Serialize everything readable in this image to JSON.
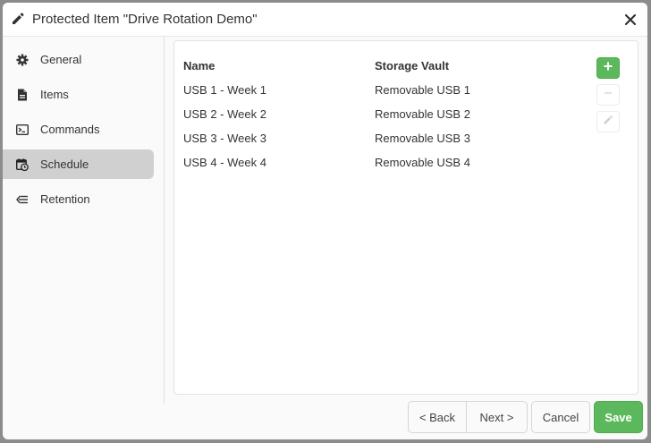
{
  "dialog": {
    "title": "Protected Item \"Drive Rotation Demo\"",
    "title_icon": "pencil-icon",
    "close_icon": "close-icon"
  },
  "sidebar": {
    "items": [
      {
        "label": "General",
        "icon": "gear-icon",
        "active": false
      },
      {
        "label": "Items",
        "icon": "document-icon",
        "active": false
      },
      {
        "label": "Commands",
        "icon": "terminal-icon",
        "active": false
      },
      {
        "label": "Schedule",
        "icon": "calendar-clock-icon",
        "active": true
      },
      {
        "label": "Retention",
        "icon": "retention-arrow-icon",
        "active": false
      }
    ]
  },
  "table": {
    "columns": [
      "Name",
      "Storage Vault"
    ],
    "rows": [
      [
        "USB 1 - Week 1",
        "Removable USB 1"
      ],
      [
        "USB 2 - Week 2",
        "Removable USB 2"
      ],
      [
        "USB 3 - Week 3",
        "Removable USB 3"
      ],
      [
        "USB 4 - Week 4",
        "Removable USB 4"
      ]
    ]
  },
  "toolbar": {
    "add_icon": "plus-icon",
    "remove_icon": "minus-icon",
    "edit_icon": "pencil-icon",
    "add_enabled": true,
    "remove_enabled": false,
    "edit_enabled": false
  },
  "footer": {
    "back_label": "< Back",
    "next_label": "Next >",
    "cancel_label": "Cancel",
    "save_label": "Save"
  },
  "colors": {
    "accent_green": "#5cb85c",
    "active_nav": "#d0d0d0"
  }
}
